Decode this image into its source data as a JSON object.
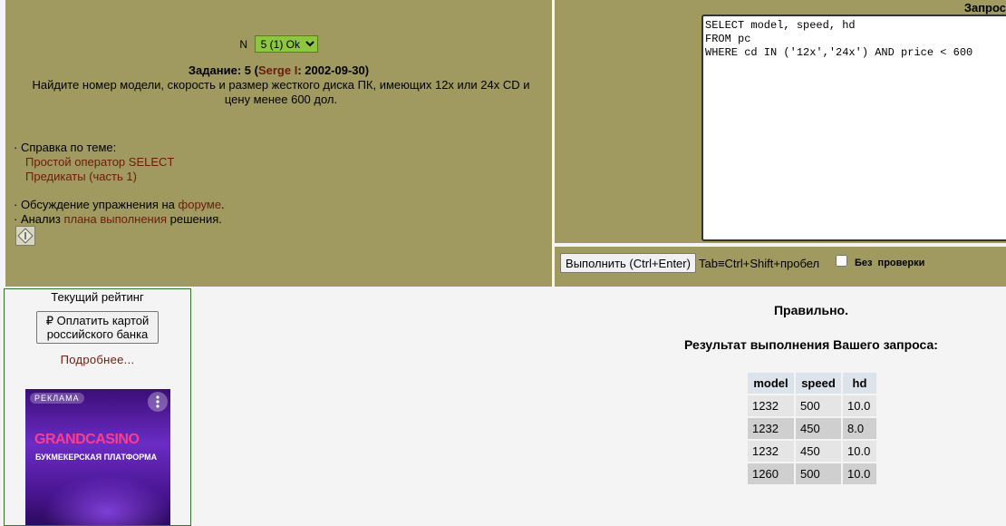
{
  "task": {
    "selector_label": "N",
    "selected_option": "5 (1) Ok",
    "heading_prefix": "Задание: 5 (",
    "author": "Serge I",
    "heading_date": ": 2002-09-30)",
    "text": "Найдите номер модели, скорость и размер жесткого диска ПК, имеющих 12x или 24x CD и цену менее 600 дол.",
    "help_title": "· Справка по теме:",
    "help_links": [
      "Простой оператор SELECT",
      "Предикаты (часть 1)"
    ],
    "discussion_prefix": "· Обсуждение упражнения на ",
    "discussion_link": "форуме",
    "discussion_suffix": ".",
    "analysis_prefix": "· Анализ ",
    "analysis_link": "плана выполнения",
    "analysis_suffix": " решения."
  },
  "query": {
    "label": "Запрос",
    "text": "SELECT model, speed, hd\nFROM pc\nWHERE cd IN ('12x','24x') AND price < 600",
    "run_button": "Выполнить (Ctrl+Enter)",
    "hotkey_hint": "Tab≡Ctrl+Shift+пробел",
    "no_check_label": "Без проверки",
    "no_check_checked": false
  },
  "sidebar": {
    "rating_title": "Текущий рейтинг",
    "pay_button": "₽ Оплатить картой российского банка",
    "more_link": "Подробнее...",
    "ad": {
      "badge": "РЕКЛАМА",
      "brand": "GRANDCASINO",
      "tagline": "БУКМЕКЕРСКАЯ ПЛАТФОРМА",
      "menu_icon": "more-vertical-icon"
    }
  },
  "result": {
    "verdict": "Правильно.",
    "title": "Результат выполнения Вашего запроса:",
    "columns": [
      "model",
      "speed",
      "hd"
    ],
    "rows": [
      [
        "1232",
        "500",
        "10.0"
      ],
      [
        "1232",
        "450",
        "8.0"
      ],
      [
        "1232",
        "450",
        "10.0"
      ],
      [
        "1260",
        "500",
        "10.0"
      ]
    ]
  },
  "colors": {
    "panel_bg": "#a09a60",
    "link": "#6b1c0b",
    "select_bg": "#8ec63f",
    "ad_brand": "#ff3d8b"
  }
}
